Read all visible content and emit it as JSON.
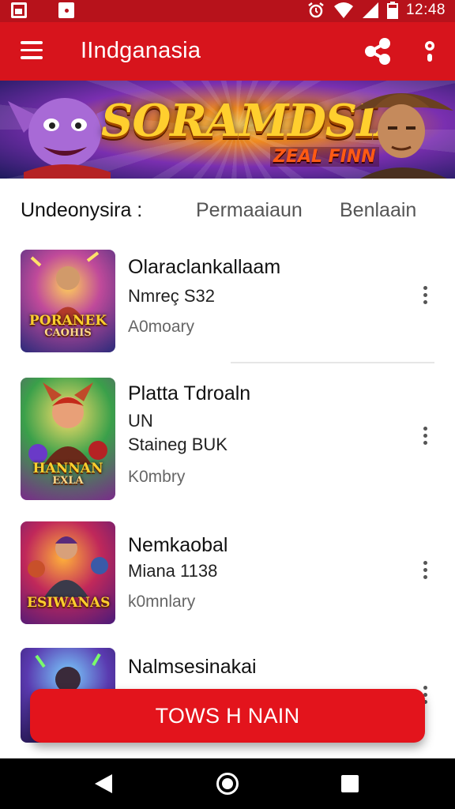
{
  "status_bar": {
    "time": "12:48"
  },
  "app_bar": {
    "title": "IIndganasia"
  },
  "banner": {
    "title": "SORAMDSIA",
    "subtitle": "ZEAL FINN"
  },
  "tabs": [
    "Undeonysira :",
    "Permaaiaun",
    "Benlaain"
  ],
  "items": [
    {
      "title": "Olaraclankallaam",
      "lines": [
        "Nmreç S32"
      ],
      "category": "A0moary",
      "art_title": "PORANEK",
      "art_sub": "CAOHIS"
    },
    {
      "title": "Platta Tdroaln",
      "lines": [
        "UN",
        "Staineg BUK"
      ],
      "category": "K0mbry",
      "art_title": "HANNAN",
      "art_sub": "EXLA"
    },
    {
      "title": "Nemkaobal",
      "lines": [
        "Miana 1138"
      ],
      "category": "k0mnlary",
      "art_title": "ESIWANAS",
      "art_sub": ""
    },
    {
      "title": "Nalmsesinakai",
      "lines": [],
      "category": "",
      "art_title": "",
      "art_sub": ""
    }
  ],
  "cta": {
    "label": "TOWS H NAIN"
  },
  "colors": {
    "primary": "#d7141c",
    "status": "#b7121b",
    "cta": "#e3141c"
  },
  "icons": {
    "menu": "hamburger-icon",
    "share": "share-icon",
    "more": "more-vert-icon"
  }
}
